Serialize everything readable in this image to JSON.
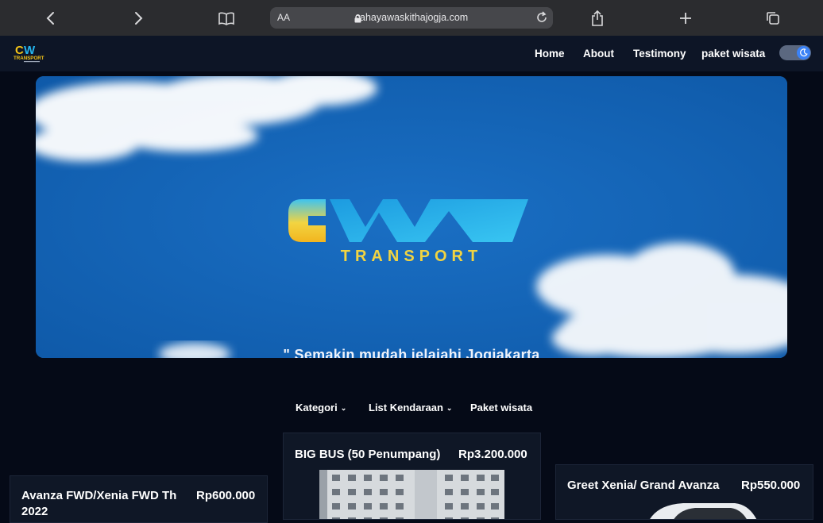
{
  "browser": {
    "text_size_label": "AA",
    "domain": "cahayawaskithajogja.com"
  },
  "header": {
    "logo_text": "CW",
    "logo_subtext": "TRANSPORT",
    "nav": [
      "Home",
      "About",
      "Testimony",
      "paket wisata"
    ]
  },
  "hero": {
    "logo_word": "TRANSPORT",
    "caption": "\" Semakin mudah jelajahi Jogjakarta"
  },
  "catbar": {
    "items": [
      "Kategori",
      "List Kendaraan",
      "Paket wisata"
    ]
  },
  "cards": [
    {
      "name": "Avanza FWD/Xenia FWD Th 2022",
      "price": "Rp600.000"
    },
    {
      "name": "BIG BUS (50 Penumpang)",
      "price": "Rp3.200.000"
    },
    {
      "name": "Greet Xenia/ Grand Avanza",
      "price": "Rp550.000"
    }
  ],
  "colors": {
    "page_bg": "#050a17",
    "header_bg": "#0d1526",
    "hero_blue": "#1566b9",
    "accent": "#3b82f6"
  }
}
